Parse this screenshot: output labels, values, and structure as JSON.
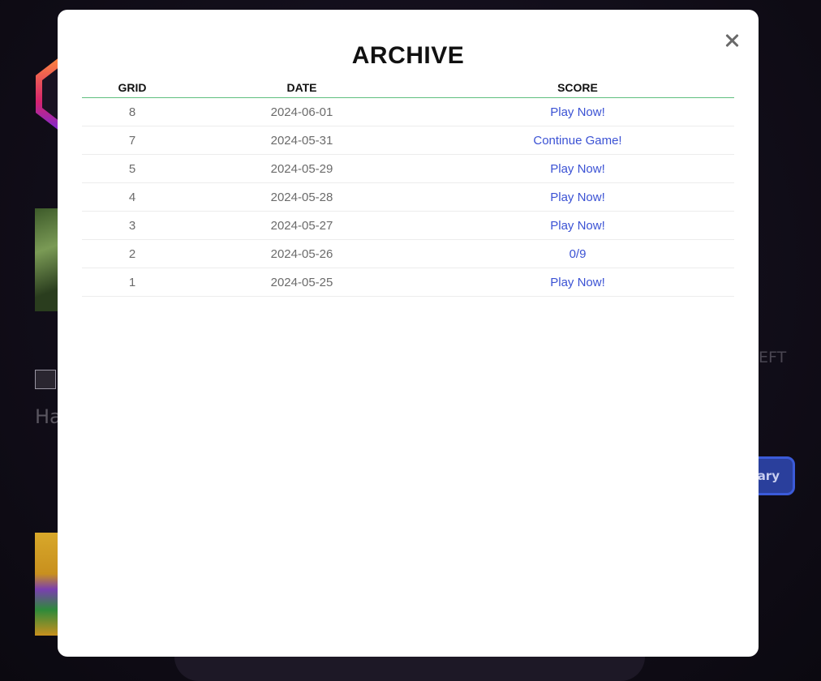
{
  "background": {
    "partial_text_left": "Ha",
    "partial_text_right": "EFT",
    "partial_button_label": "ary"
  },
  "modal": {
    "title": "ARCHIVE",
    "close_icon": "close-icon",
    "columns": [
      "GRID",
      "DATE",
      "SCORE"
    ],
    "rows": [
      {
        "grid": "8",
        "date": "2024-06-01",
        "score": "Play Now!"
      },
      {
        "grid": "7",
        "date": "2024-05-31",
        "score": "Continue Game!"
      },
      {
        "grid": "5",
        "date": "2024-05-29",
        "score": "Play Now!"
      },
      {
        "grid": "4",
        "date": "2024-05-28",
        "score": "Play Now!"
      },
      {
        "grid": "3",
        "date": "2024-05-27",
        "score": "Play Now!"
      },
      {
        "grid": "2",
        "date": "2024-05-26",
        "score": "0/9"
      },
      {
        "grid": "1",
        "date": "2024-05-25",
        "score": "Play Now!"
      }
    ]
  },
  "colors": {
    "link": "#3b52d4",
    "header_rule": "#5fbf7f",
    "modal_bg": "#ffffff",
    "page_bg": "#120e1a"
  }
}
